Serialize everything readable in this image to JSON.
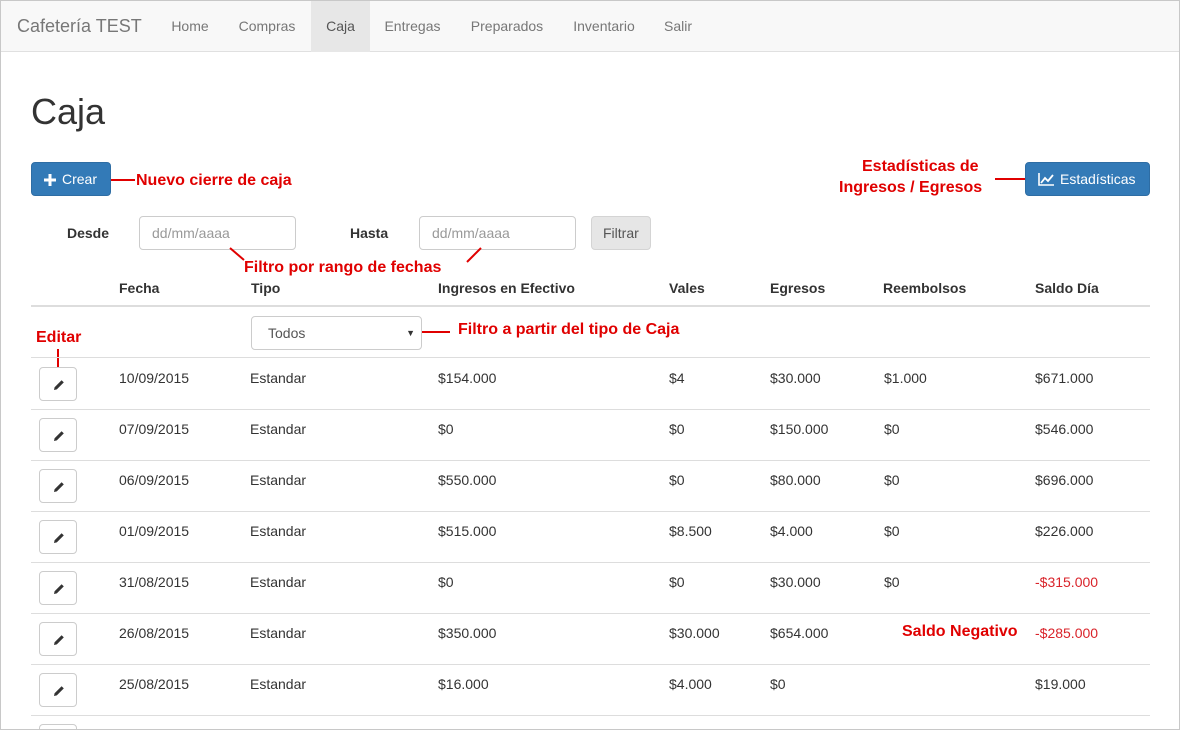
{
  "navbar": {
    "brand": "Cafetería TEST",
    "items": [
      {
        "label": "Home",
        "active": false
      },
      {
        "label": "Compras",
        "active": false
      },
      {
        "label": "Caja",
        "active": true
      },
      {
        "label": "Entregas",
        "active": false
      },
      {
        "label": "Preparados",
        "active": false
      },
      {
        "label": "Inventario",
        "active": false
      },
      {
        "label": "Salir",
        "active": false
      }
    ]
  },
  "page": {
    "title": "Caja",
    "create_label": "Crear",
    "stats_label": "Estadísticas"
  },
  "filters": {
    "from_label": "Desde",
    "to_label": "Hasta",
    "from_placeholder": "dd/mm/aaaa",
    "to_placeholder": "dd/mm/aaaa",
    "filter_label": "Filtrar",
    "type_selected": "Todos"
  },
  "annotations": {
    "create": "Nuevo cierre de caja",
    "stats_line1": "Estadísticas de",
    "stats_line2": "Ingresos / Egresos",
    "date_range": "Filtro por rango de fechas",
    "type_filter": "Filtro a partir del tipo de Caja",
    "edit": "Editar",
    "negative": "Saldo Negativo"
  },
  "table": {
    "headers": [
      "Fecha",
      "Tipo",
      "Ingresos en Efectivo",
      "Vales",
      "Egresos",
      "Reembolsos",
      "Saldo Día"
    ],
    "rows": [
      {
        "fecha": "10/09/2015",
        "tipo": "Estandar",
        "ingresos": "$154.000",
        "vales": "$4",
        "egresos": "$30.000",
        "reembolsos": "$1.000",
        "saldo": "$671.000",
        "negative": false
      },
      {
        "fecha": "07/09/2015",
        "tipo": "Estandar",
        "ingresos": "$0",
        "vales": "$0",
        "egresos": "$150.000",
        "reembolsos": "$0",
        "saldo": "$546.000",
        "negative": false
      },
      {
        "fecha": "06/09/2015",
        "tipo": "Estandar",
        "ingresos": "$550.000",
        "vales": "$0",
        "egresos": "$80.000",
        "reembolsos": "$0",
        "saldo": "$696.000",
        "negative": false
      },
      {
        "fecha": "01/09/2015",
        "tipo": "Estandar",
        "ingresos": "$515.000",
        "vales": "$8.500",
        "egresos": "$4.000",
        "reembolsos": "$0",
        "saldo": "$226.000",
        "negative": false
      },
      {
        "fecha": "31/08/2015",
        "tipo": "Estandar",
        "ingresos": "$0",
        "vales": "$0",
        "egresos": "$30.000",
        "reembolsos": "$0",
        "saldo": "-$315.000",
        "negative": true
      },
      {
        "fecha": "26/08/2015",
        "tipo": "Estandar",
        "ingresos": "$350.000",
        "vales": "$30.000",
        "egresos": "$654.000",
        "reembolsos": "",
        "saldo": "-$285.000",
        "negative": true
      },
      {
        "fecha": "25/08/2015",
        "tipo": "Estandar",
        "ingresos": "$16.000",
        "vales": "$4.000",
        "egresos": "$0",
        "reembolsos": "",
        "saldo": "$19.000",
        "negative": false
      }
    ]
  },
  "colors": {
    "primary": "#337ab7",
    "annotation": "#e00000",
    "negative": "#d9232a"
  }
}
